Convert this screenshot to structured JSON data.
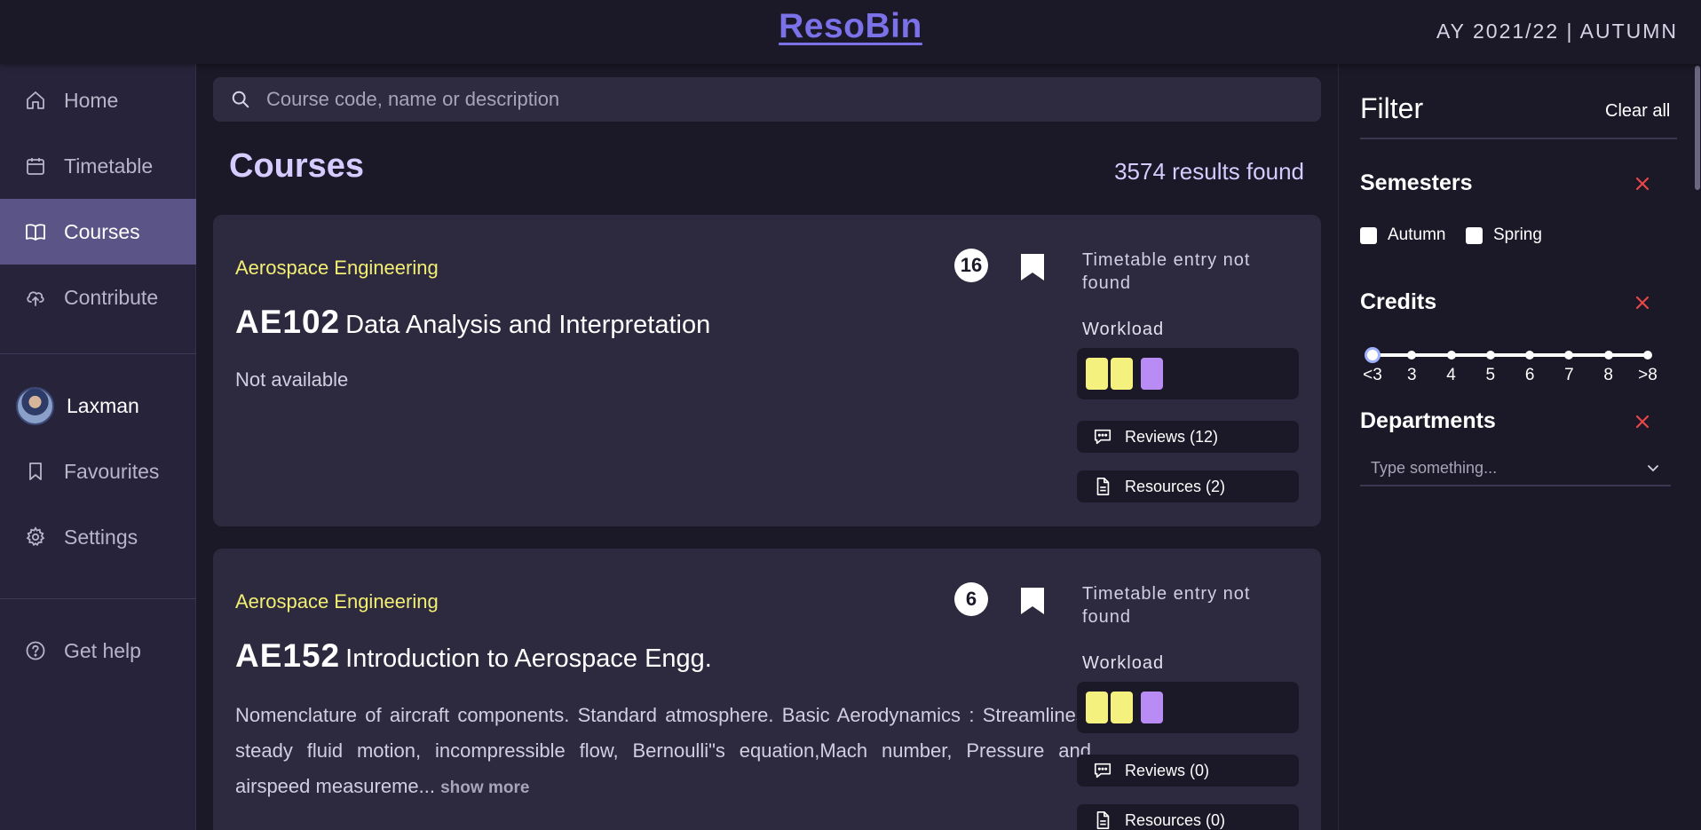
{
  "header": {
    "brand": "ResoBin",
    "term": "AY 2021/22 | AUTUMN"
  },
  "sidebar": {
    "items": [
      {
        "label": "Home"
      },
      {
        "label": "Timetable"
      },
      {
        "label": "Courses"
      },
      {
        "label": "Contribute"
      }
    ],
    "user": {
      "name": "Laxman"
    },
    "user_items": [
      {
        "label": "Favourites"
      },
      {
        "label": "Settings"
      }
    ],
    "help": {
      "label": "Get help"
    }
  },
  "search": {
    "placeholder": "Course code, name or description",
    "value": ""
  },
  "main": {
    "title": "Courses",
    "results": "3574 results found"
  },
  "courses": [
    {
      "department": "Aerospace Engineering",
      "code": "AE102",
      "title": "Data Analysis and Interpretation",
      "description": "Not available",
      "show_more": "",
      "count": "16",
      "timetable_note": "Timetable entry not found",
      "workload_label": "Workload",
      "reviews": "Reviews (12)",
      "resources": "Resources (2)"
    },
    {
      "department": "Aerospace Engineering",
      "code": "AE152",
      "title": "Introduction to Aerospace Engg.",
      "description": "Nomenclature of aircraft components. Standard atmosphere. Basic Aerodynamics : Streamlines, steady fluid motion, incompressible flow, Bernoulli\"s equation,Mach number, Pressure and airspeed measureme... ",
      "show_more": "show more",
      "count": "6",
      "timetable_note": "Timetable entry not found",
      "workload_label": "Workload",
      "reviews": "Reviews (0)",
      "resources": "Resources (0)"
    }
  ],
  "filter": {
    "title": "Filter",
    "clear": "Clear all",
    "semesters": {
      "label": "Semesters",
      "options": [
        "Autumn",
        "Spring"
      ]
    },
    "credits": {
      "label": "Credits",
      "ticks": [
        "<3",
        "3",
        "4",
        "5",
        "6",
        "7",
        "8",
        ">8"
      ],
      "selected_min": "<3"
    },
    "departments": {
      "label": "Departments",
      "placeholder": "Type something..."
    }
  },
  "colors": {
    "accent": "#7b72e9",
    "department": "#f3ee74",
    "workload_yellow": "#f4f17e",
    "workload_purple": "#b98cf5",
    "remove": "#e84848",
    "active_nav": "#5b5486"
  }
}
